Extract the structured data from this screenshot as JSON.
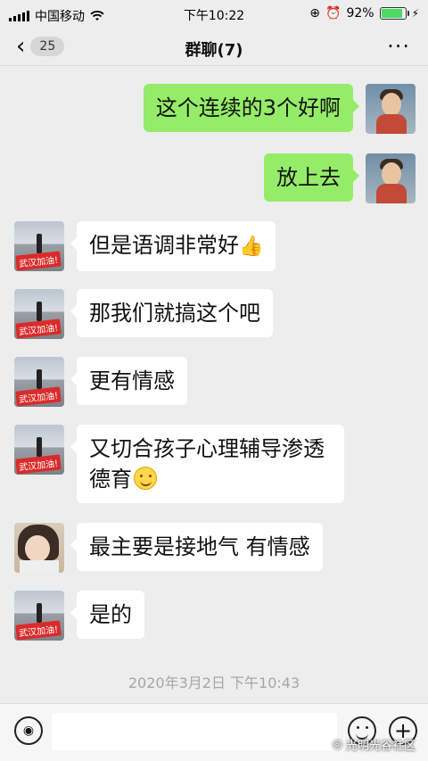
{
  "status_bar": {
    "carrier": "中国移动",
    "time": "下午10:22",
    "battery": "92%",
    "battery_level": 0.92
  },
  "nav": {
    "back_count": "25",
    "title": "群聊(7)",
    "more_icon": "more-dots-icon"
  },
  "messages": [
    {
      "sender": "self",
      "text": "这个连续的3个好啊"
    },
    {
      "sender": "self",
      "text": "放上去"
    },
    {
      "sender": "other",
      "avatar_tag": "武汉加油!",
      "text": "但是语调非常好",
      "emoji": "👍"
    },
    {
      "sender": "other",
      "avatar_tag": "武汉加油!",
      "text": "那我们就搞这个吧"
    },
    {
      "sender": "other",
      "avatar_tag": "武汉加油!",
      "text": "更有情感"
    },
    {
      "sender": "other",
      "avatar_tag": "武汉加油!",
      "text": "又切合孩子心理辅导渗透德育",
      "emoji": "smile-emoji"
    },
    {
      "sender": "other2",
      "text": "最主要是接地气 有情感"
    },
    {
      "sender": "other",
      "avatar_tag": "武汉加油!",
      "text": "是的"
    }
  ],
  "timestamp": "2020年3月2日 下午10:43",
  "input_bar": {
    "placeholder": "",
    "watermark": "光明光谷社区"
  },
  "colors": {
    "outgoing_bubble": "#95ec69",
    "incoming_bubble": "#ffffff",
    "background": "#ededed"
  }
}
